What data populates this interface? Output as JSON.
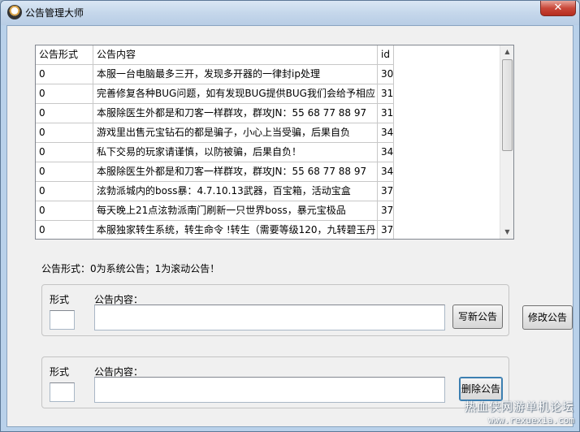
{
  "window": {
    "title": "公告管理大师",
    "close_label": "✕"
  },
  "table": {
    "columns": [
      "公告形式",
      "公告内容",
      "id"
    ],
    "rows": [
      [
        "0",
        "本服一台电脑最多三开，发现多开器的一律封ip处理",
        "30"
      ],
      [
        "0",
        "完善修复各种BUG问题，如有发现BUG提供BUG我们会给予相应",
        "31"
      ],
      [
        "0",
        "本服除医生外都是和刀客一样群攻，群攻JN：55 68 77 88 97",
        "31"
      ],
      [
        "0",
        "游戏里出售元宝钻石的都是骗子，小心上当受骗，后果自负",
        "34"
      ],
      [
        "0",
        "私下交易的玩家请谨慎，以防被骗，后果自负！",
        "34"
      ],
      [
        "0",
        "本服除医生外都是和刀客一样群攻，群攻JN：55 68 77 88 97",
        "34"
      ],
      [
        "0",
        "泫勃派城内的boss暴：4.7.10.13武器，百宝箱，活动宝盒",
        "37"
      ],
      [
        "0",
        "每天晚上21点泫勃派南门刷新一只世界boss，暴元宝极品",
        "37"
      ],
      [
        "0",
        "本服独家转生系统，转生命令 !转生（需要等级120，九转碧玉丹",
        "37"
      ]
    ]
  },
  "hint": "公告形式：0为系统公告；1为滚动公告！",
  "form1": {
    "type_label": "形式",
    "content_label": "公告内容：",
    "type_value": "",
    "content_value": "",
    "add_button": "写新公告",
    "edit_button": "修改公告"
  },
  "form2": {
    "type_label": "形式",
    "content_label": "公告内容：",
    "type_value": "",
    "content_value": "",
    "delete_button": "删除公告"
  },
  "watermark": {
    "line1": "热血侠网游单机论坛",
    "line2": "www.rexuexia.com"
  }
}
